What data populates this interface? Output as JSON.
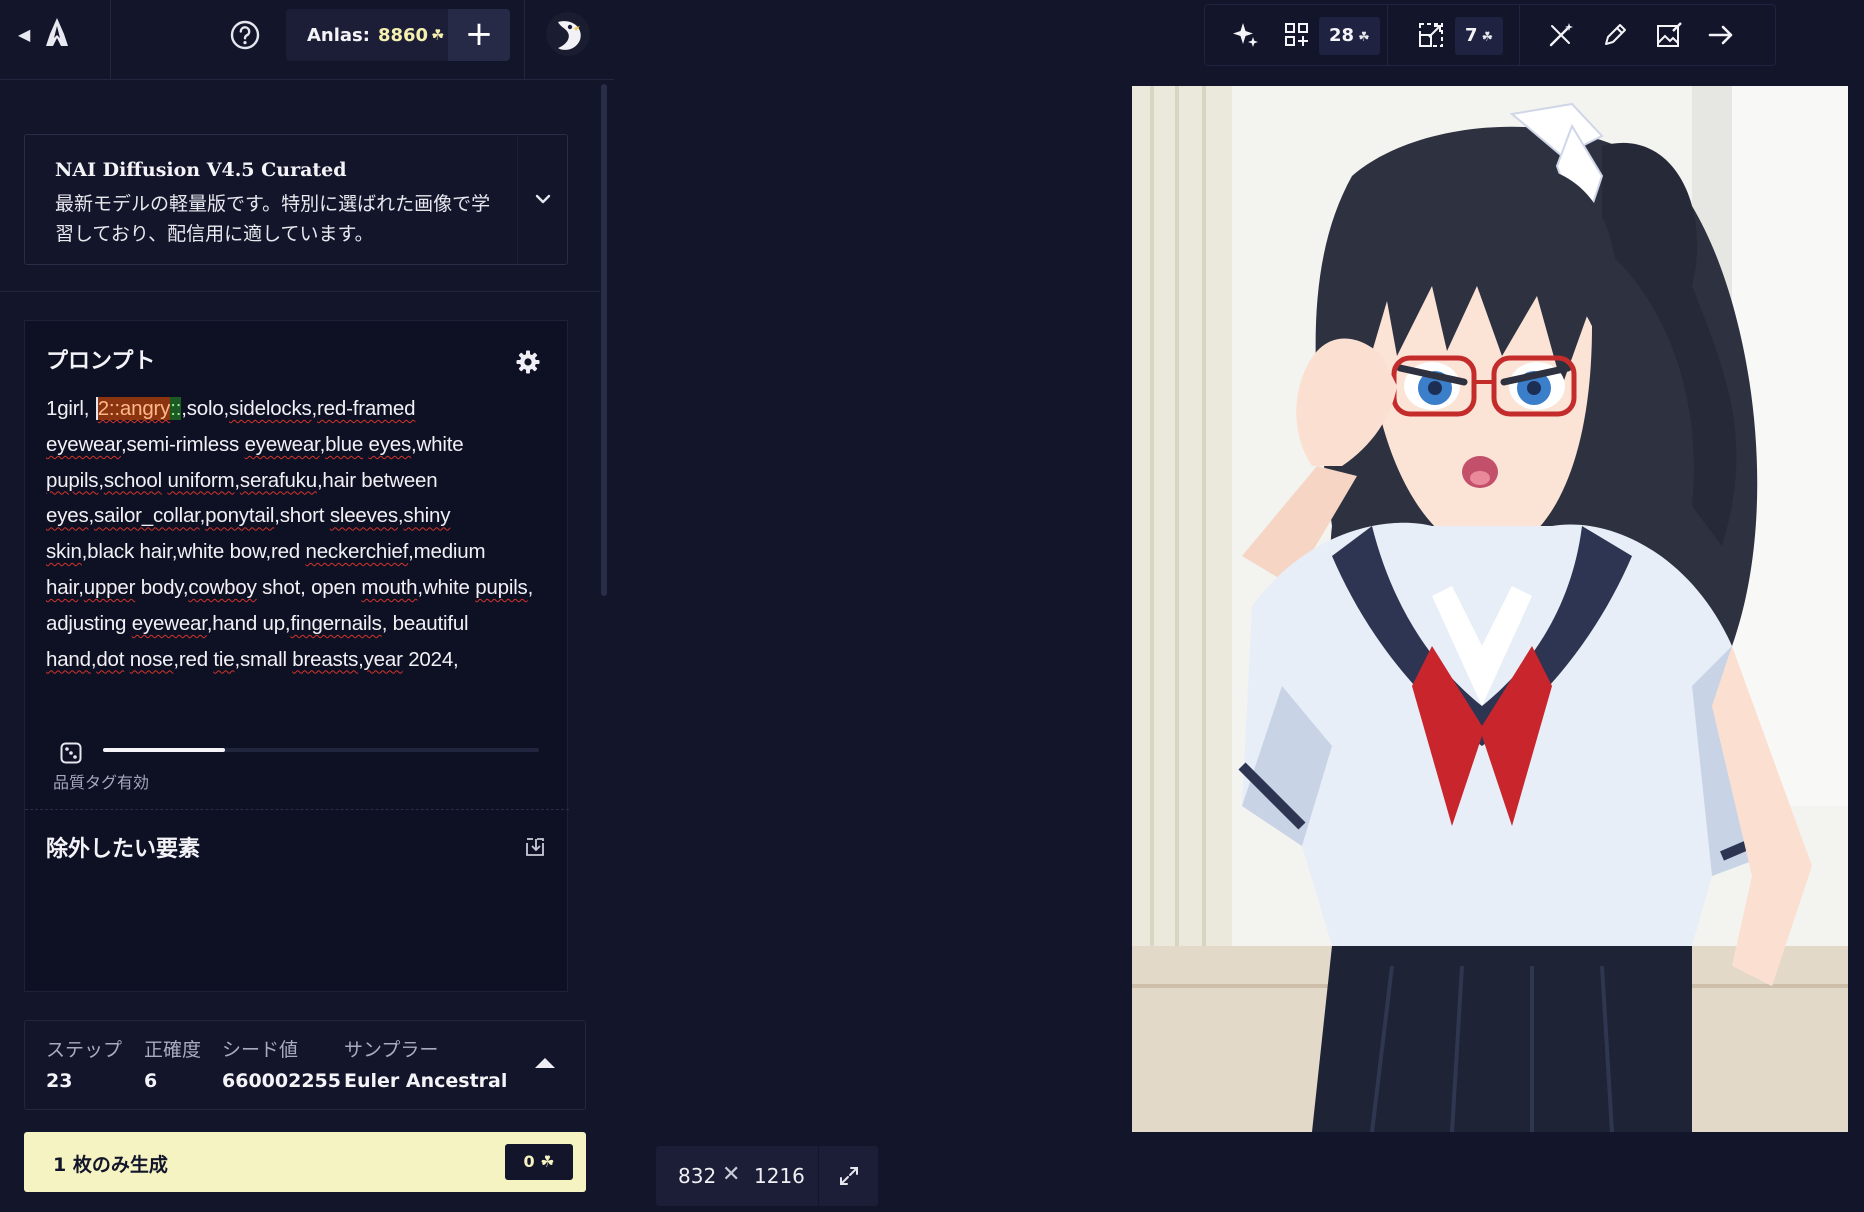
{
  "header": {
    "anlas_label": "Anlas:",
    "anlas_value": "8860",
    "add_label": "+"
  },
  "model": {
    "name": "NAI Diffusion V4.5 Curated",
    "description": "最新モデルの軽量版です。特別に選ばれた画像で学習しており、配信用に適しています。"
  },
  "prompt": {
    "title": "プロンプト",
    "quality_label": "品質タグ有効",
    "quality_level": 0.28
  },
  "negative": {
    "title": "除外したい要素"
  },
  "settings_summary": {
    "steps_label": "ステップ",
    "steps_value": "23",
    "guidance_label": "正確度",
    "guidance_value": "6",
    "seed_label": "シード値",
    "seed_value": "660002255",
    "sampler_label": "サンプラー",
    "sampler_value": "Euler Ancestral"
  },
  "generate": {
    "label": "1 枚のみ生成",
    "cost": "0"
  },
  "toolbar": {
    "variations_cost": "28",
    "upscale_cost": "7"
  },
  "dimensions": {
    "width": "832",
    "separator": "✕",
    "height": "1216"
  },
  "colors": {
    "background": "#13152b",
    "panel": "#0e1024",
    "accent_yellow": "#f5f3c1",
    "anlas_value": "#f5f0b0",
    "emphasis_highlight": "#8a3510",
    "colon_highlight": "#1d5a23",
    "spellcheck_underline": "#d2352a"
  },
  "icons": [
    "back-icon",
    "nai-logo-icon",
    "help-icon",
    "plus-icon",
    "avatar",
    "chevron-down-icon",
    "gear-icon",
    "dice-icon",
    "import-icon",
    "caret-up-icon",
    "sparkle-icon",
    "variations-icon",
    "upscale-icon",
    "magic-wand-icon",
    "pencil-icon",
    "image-edit-icon",
    "arrow-right-icon",
    "expand-icon"
  ]
}
